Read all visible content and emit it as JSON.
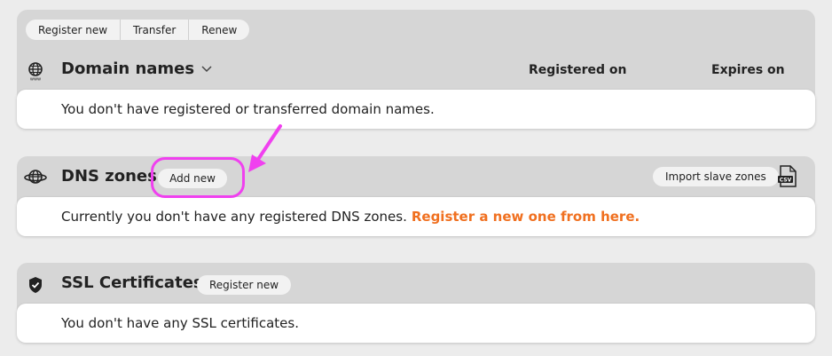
{
  "domains": {
    "actions": [
      "Register new",
      "Transfer",
      "Renew"
    ],
    "title": "Domain names",
    "col_registered": "Registered on",
    "col_expires": "Expires on",
    "empty_message": "You don't have registered or transferred domain names."
  },
  "dns": {
    "title": "DNS zones",
    "add_label": "Add new",
    "import_label": "Import slave zones",
    "empty_message": "Currently you don't have any registered DNS zones.",
    "register_link": "Register a new one from here."
  },
  "ssl": {
    "title": "SSL Certificates",
    "register_label": "Register new",
    "empty_message": "You don't have any SSL certificates."
  },
  "colors": {
    "link_accent": "#f07020",
    "annotation": "#f040ef"
  }
}
